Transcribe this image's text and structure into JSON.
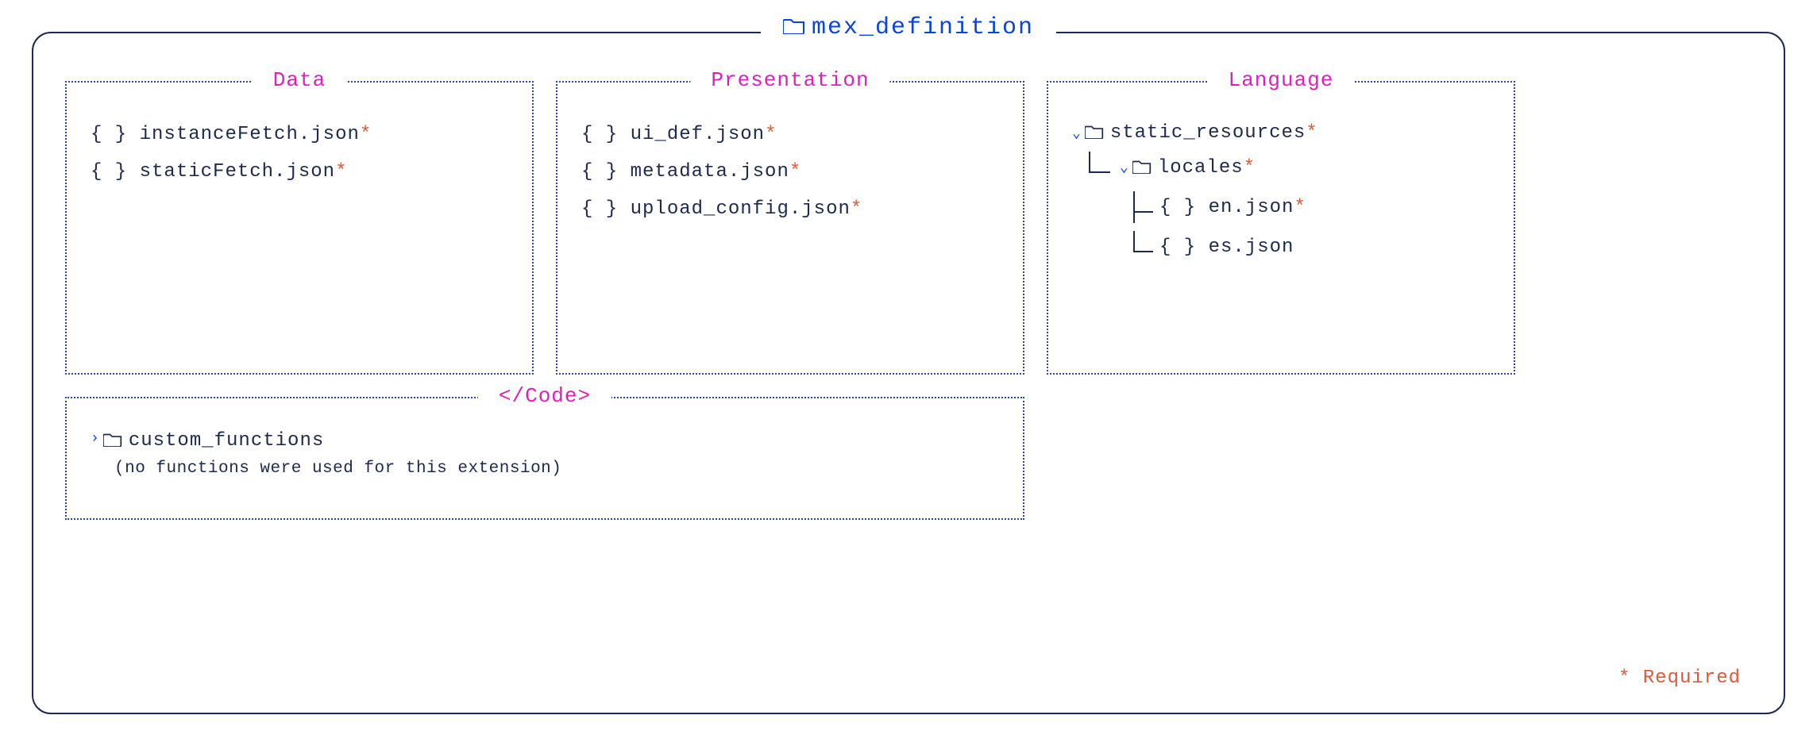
{
  "root": {
    "title": "mex_definition"
  },
  "panels": {
    "data": {
      "title": "Data",
      "items": [
        {
          "label": "instanceFetch.json",
          "required": true
        },
        {
          "label": "staticFetch.json",
          "required": true
        }
      ]
    },
    "presentation": {
      "title": "Presentation",
      "items": [
        {
          "label": "ui_def.json",
          "required": true
        },
        {
          "label": "metadata.json",
          "required": true
        },
        {
          "label": "upload_config.json",
          "required": true
        }
      ]
    },
    "language": {
      "title": "Language",
      "tree": {
        "static_resources": {
          "label": "static_resources",
          "required": true
        },
        "locales": {
          "label": "locales",
          "required": true
        },
        "en": {
          "label": "en.json",
          "required": true
        },
        "es": {
          "label": "es.json",
          "required": false
        }
      }
    },
    "code": {
      "title": "</Code>",
      "folder": "custom_functions",
      "note": "(no functions were used for this extension)"
    }
  },
  "legend": {
    "required": "* Required"
  },
  "glyphs": {
    "braces": "{ }",
    "asterisk": "*"
  }
}
